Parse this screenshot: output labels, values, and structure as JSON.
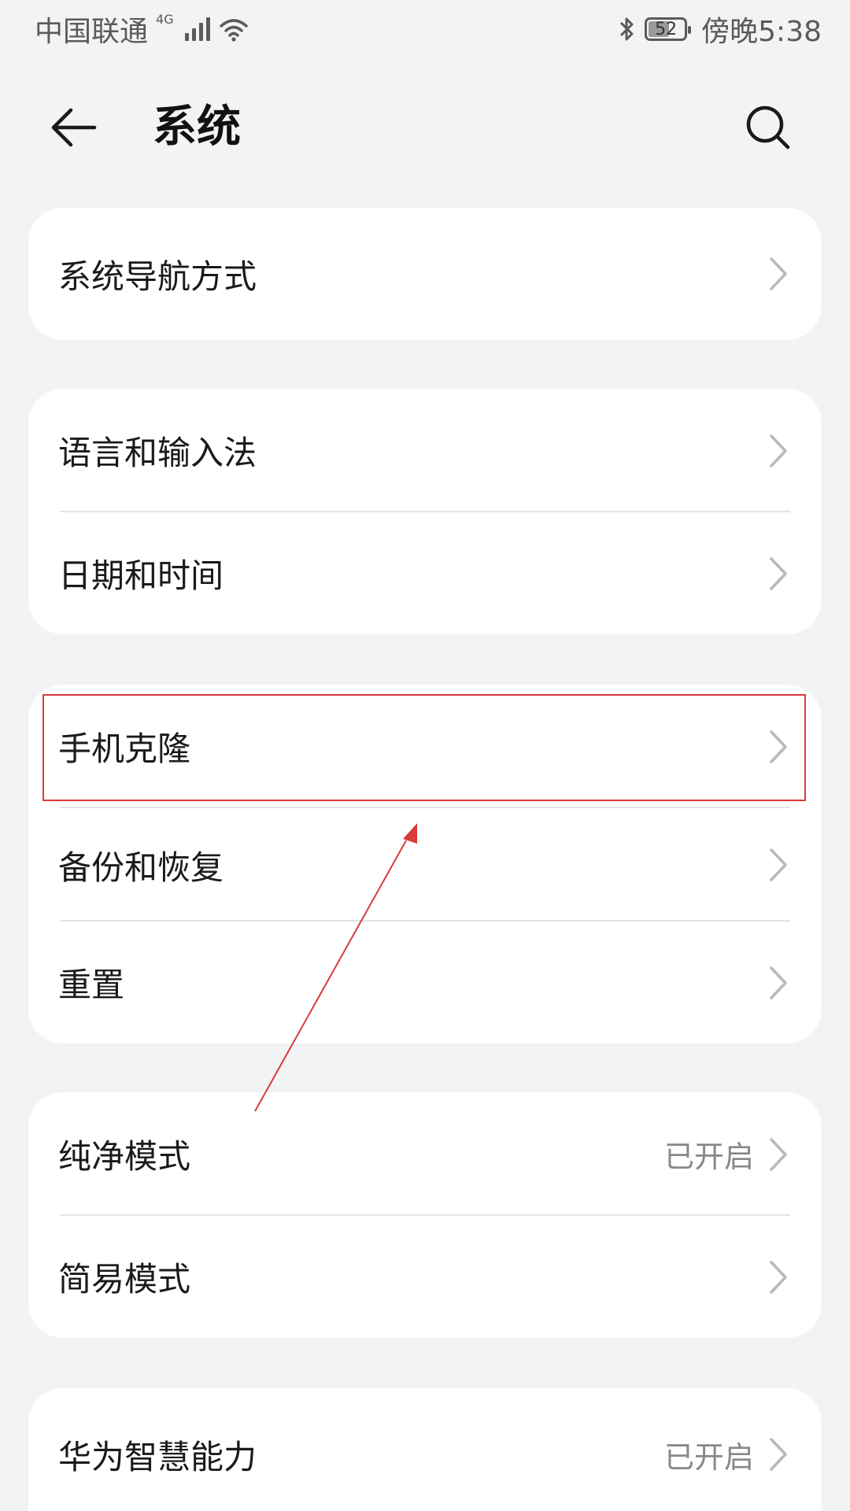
{
  "status_bar": {
    "carrier": "中国联通",
    "network": "4G",
    "battery": "52",
    "time": "傍晚5:38"
  },
  "header": {
    "title": "系统"
  },
  "cards": [
    {
      "rows": [
        {
          "label": "系统导航方式"
        }
      ]
    },
    {
      "rows": [
        {
          "label": "语言和输入法"
        },
        {
          "label": "日期和时间"
        }
      ]
    },
    {
      "rows": [
        {
          "label": "手机克隆"
        },
        {
          "label": "备份和恢复"
        },
        {
          "label": "重置"
        }
      ]
    },
    {
      "rows": [
        {
          "label": "纯净模式",
          "value": "已开启"
        },
        {
          "label": "简易模式"
        }
      ]
    },
    {
      "rows": [
        {
          "label": "华为智慧能力",
          "value": "已开启"
        }
      ]
    }
  ],
  "colors": {
    "accent_annotation": "#d93a3a",
    "background": "#f1f3f5"
  },
  "icons": {
    "back": "arrow-left-icon",
    "search": "search-icon",
    "row": "chevron-right-icon"
  }
}
